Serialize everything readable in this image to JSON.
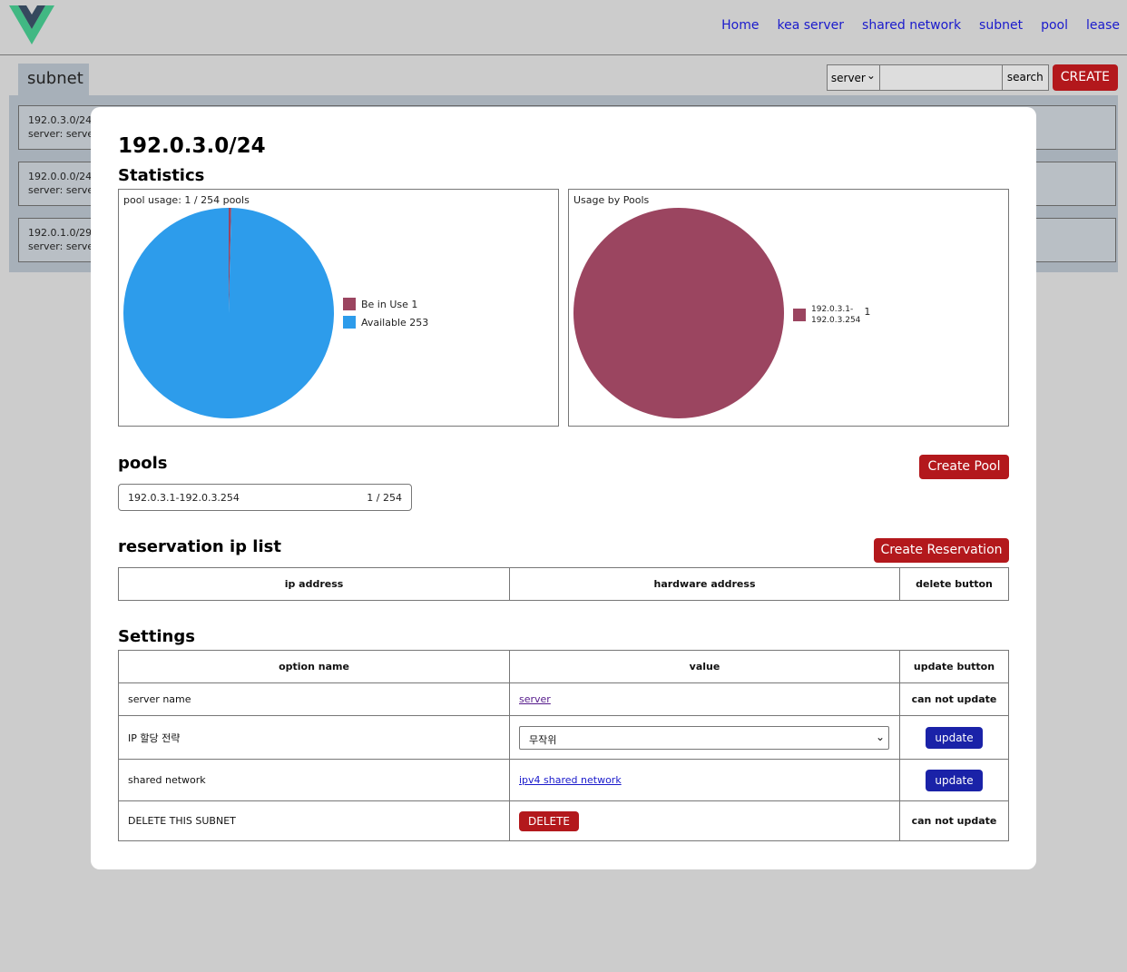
{
  "nav": {
    "items": [
      "Home",
      "kea server",
      "shared network",
      "subnet",
      "pool",
      "lease"
    ]
  },
  "page": {
    "tab_label": "subnet",
    "server_select_value": "server",
    "search_button": "search",
    "create_button": "CREATE"
  },
  "subnet_list": [
    {
      "subnet": "192.0.3.0/24",
      "server": "server: server"
    },
    {
      "subnet": "192.0.0.0/24",
      "server": "server: server"
    },
    {
      "subnet": "192.0.1.0/29",
      "server": "server: server"
    }
  ],
  "modal": {
    "title": "192.0.3.0/24",
    "statistics_heading": "Statistics",
    "pools_heading": "pools",
    "create_pool_button": "Create Pool",
    "pool_item": {
      "range": "192.0.3.1-192.0.3.254",
      "usage": "1 / 254"
    },
    "reservation_heading": "reservation ip list",
    "create_reservation_button": "Create Reservation",
    "reservation_columns": [
      "ip address",
      "hardware address",
      "delete button"
    ],
    "settings_heading": "Settings",
    "settings_columns": [
      "option name",
      "value",
      "update button"
    ],
    "settings_rows": [
      {
        "name": "server name",
        "value": "server",
        "action": "can not update"
      },
      {
        "name": "IP 할당 전략",
        "value": "무작위",
        "action": "update"
      },
      {
        "name": "shared network",
        "value": "ipv4 shared network",
        "action": "update"
      },
      {
        "name": "DELETE THIS SUBNET",
        "value": "DELETE",
        "action": "can not update"
      }
    ]
  },
  "chart_data": [
    {
      "type": "pie",
      "title": "pool usage: 1 / 254 pools",
      "categories": [
        "Be in Use",
        "Available"
      ],
      "values": [
        1,
        253
      ],
      "colors": [
        "#9b4560",
        "#2d9ceb"
      ],
      "legend": "right"
    },
    {
      "type": "pie",
      "title": "Usage by Pools",
      "categories": [
        "192.0.3.1-192.0.3.254"
      ],
      "category_lines": [
        "192.0.3.1-",
        "192.0.3.254"
      ],
      "values": [
        1
      ],
      "colors": [
        "#9b4560"
      ],
      "legend": "right"
    }
  ]
}
